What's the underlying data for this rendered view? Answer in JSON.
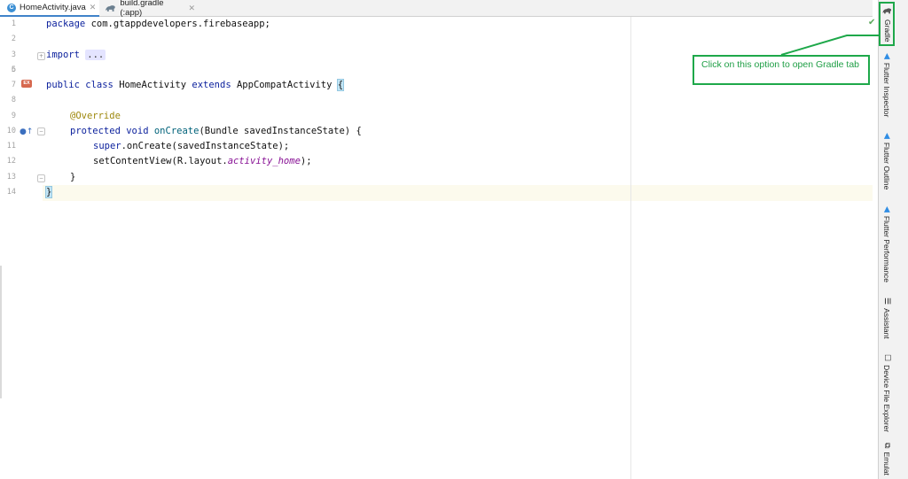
{
  "tabs": [
    {
      "label": "HomeActivity.java",
      "icon": "java-class-icon",
      "active": true
    },
    {
      "label": "build.gradle (:app)",
      "icon": "gradle-icon",
      "active": false
    }
  ],
  "code": {
    "line_numbers": [
      "1",
      "3",
      "6",
      "7",
      "8",
      "9",
      "10",
      "11",
      "12",
      "13",
      "14"
    ],
    "lines": {
      "l1": {
        "kw": "package",
        "rest": " com.gtappdevelopers.firebaseapp;"
      },
      "l3": {
        "kw": "import",
        "folded": "..."
      },
      "l7": {
        "kw1": "public",
        "kw2": "class",
        "name": "HomeActivity",
        "kw3": "extends",
        "parent": "AppCompatActivity",
        "brace": "{"
      },
      "l9": {
        "annotation": "@Override"
      },
      "l10": {
        "kw1": "protected",
        "kw2": "void",
        "fn": "onCreate",
        "rest": "(Bundle savedInstanceState) {"
      },
      "l11": {
        "kw": "super",
        "rest": ".onCreate(savedInstanceState);"
      },
      "l12": {
        "pre": "setContentView(R.layout.",
        "italic": "activity_home",
        "post": ");"
      },
      "l13": {
        "text": "}"
      },
      "l14": {
        "text": "}"
      }
    },
    "gutter_badges": {
      "extends_badge": "EX"
    }
  },
  "right_sidebar": {
    "tabs": [
      {
        "label": "Gradle",
        "icon": "gradle-icon"
      },
      {
        "label": "Flutter Inspector",
        "icon": "flutter-icon"
      },
      {
        "label": "Flutter Outline",
        "icon": "flutter-icon"
      },
      {
        "label": "Flutter Performance",
        "icon": "flutter-icon"
      },
      {
        "label": "Assistant",
        "icon": "list-icon"
      },
      {
        "label": "Device File Explorer",
        "icon": "device-icon"
      },
      {
        "label": "Emulat",
        "icon": "emulator-icon"
      }
    ]
  },
  "callout": {
    "text": "Click on this option to open Gradle tab",
    "color": "#1ea84a"
  }
}
